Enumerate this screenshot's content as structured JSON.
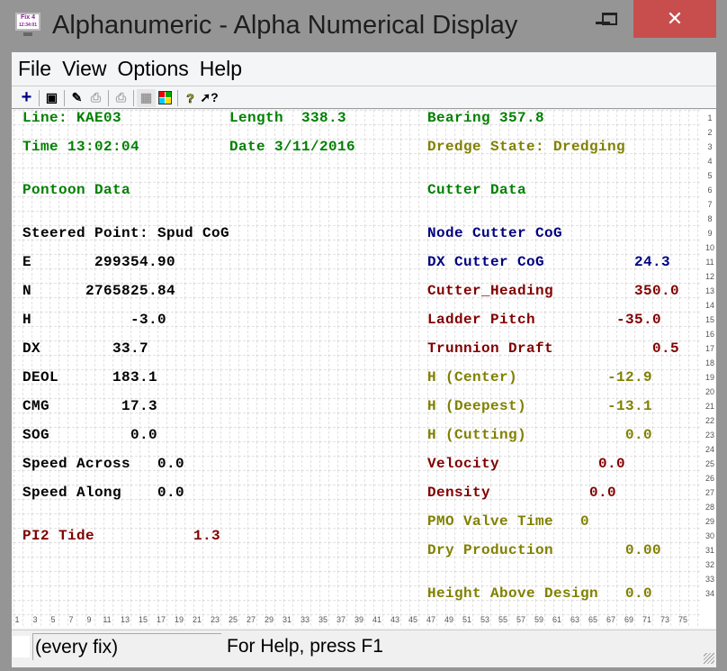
{
  "window": {
    "title": "Alphanumeric - Alpha Numerical Display",
    "icon_text": "Fix 4",
    "icon_time": "12:34:01",
    "close": "✕"
  },
  "menu": [
    "File",
    "View",
    "Options",
    "Help"
  ],
  "toolbar": [
    "add-icon",
    "select-display-icon",
    "magic-wand-icon",
    "print-icon",
    "print-preview-icon",
    "grid-icon",
    "color-palette-icon",
    "help-icon",
    "context-help-icon"
  ],
  "colors": {
    "green": "#008000",
    "olive": "#808000",
    "navy": "#000080",
    "maroon": "#800000"
  },
  "display": {
    "line": "Line: KAE03",
    "length": "Length  338.3",
    "bearing": "Bearing 357.8",
    "time": "Time 13:02:04",
    "date": "Date 3/11/2016",
    "dredge_state": "Dredge State: Dredging",
    "pontoon_header": "Pontoon Data",
    "cutter_header": "Cutter Data",
    "steered_point": "Steered Point: Spud CoG",
    "node": "Node Cutter CoG",
    "left": [
      {
        "label": "E",
        "value": "299354.90"
      },
      {
        "label": "N",
        "value": "2765825.84"
      },
      {
        "label": "H",
        "value": "-3.0"
      },
      {
        "label": "DX",
        "value": "33.7"
      },
      {
        "label": "DEOL",
        "value": "183.1"
      },
      {
        "label": "CMG",
        "value": "17.3"
      },
      {
        "label": "SOG",
        "value": "0.0"
      },
      {
        "label": "Speed Across",
        "value": "0.0"
      },
      {
        "label": "Speed Along",
        "value": "0.0"
      },
      {
        "label": "PI2 Tide",
        "value": "1.3"
      }
    ],
    "right": [
      {
        "label": "DX Cutter CoG",
        "value": "24.3"
      },
      {
        "label": "Cutter_Heading",
        "value": "350.0"
      },
      {
        "label": "Ladder Pitch",
        "value": "-35.0"
      },
      {
        "label": "Trunnion Draft",
        "value": "0.5"
      },
      {
        "label": "H (Center)",
        "value": "-12.9"
      },
      {
        "label": "H (Deepest)",
        "value": "-13.1"
      },
      {
        "label": "H (Cutting)",
        "value": "0.0"
      },
      {
        "label": "Velocity",
        "value": "0.0"
      },
      {
        "label": "Density",
        "value": "0.0"
      },
      {
        "label": "PMO Valve Time",
        "value": "0"
      },
      {
        "label": "Dry Production",
        "value": "0.00"
      },
      {
        "label": "Height Above Design",
        "value": "0.0"
      }
    ]
  },
  "status": {
    "mode": "(every fix)",
    "help": "For Help, press F1"
  }
}
